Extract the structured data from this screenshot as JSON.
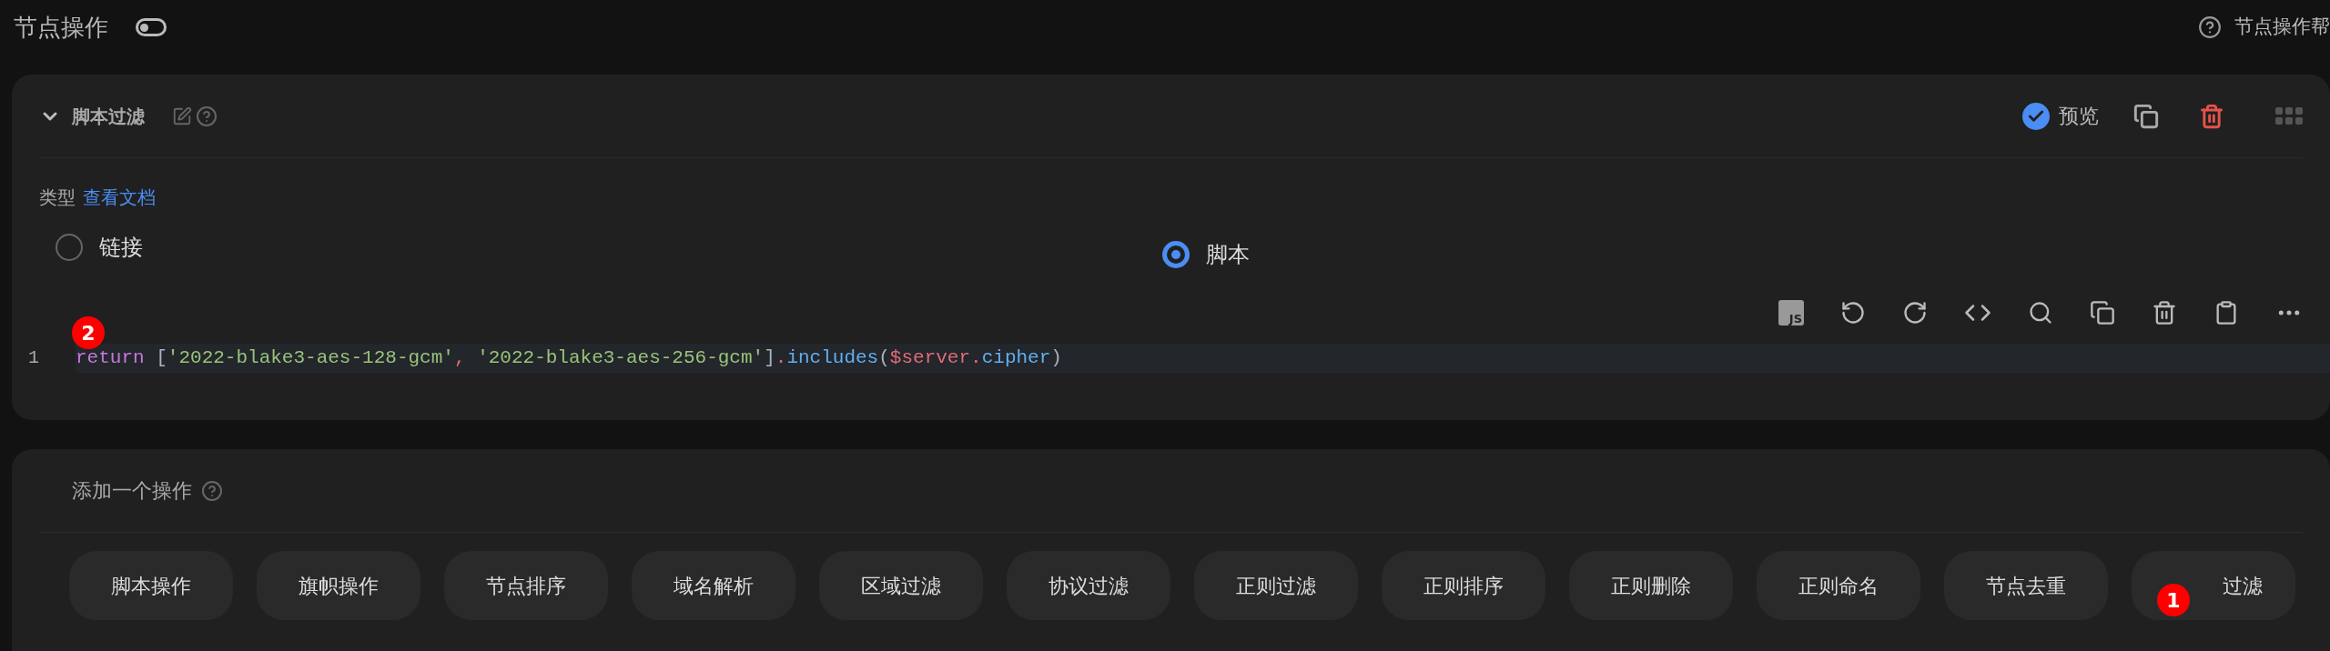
{
  "header": {
    "title": "节点操作",
    "toggle_on": false,
    "help": "节点操作帮"
  },
  "operation": {
    "title": "脚本过滤",
    "expanded": true,
    "preview": {
      "label": "预览",
      "checked": true
    },
    "type_label": "类型",
    "docs_link": "查看文档",
    "types": [
      {
        "label": "链接",
        "selected": false
      },
      {
        "label": "脚本",
        "selected": true
      }
    ],
    "editor": {
      "line_number": "1",
      "tokens": [
        {
          "kind": "keyword",
          "text": "return"
        },
        {
          "kind": "plain",
          "text": " ["
        },
        {
          "kind": "string",
          "text": "'2022-blake3-aes-128-gcm'"
        },
        {
          "kind": "punct",
          "text": ", "
        },
        {
          "kind": "string",
          "text": "'2022-blake3-aes-256-gcm'"
        },
        {
          "kind": "plain",
          "text": "]"
        },
        {
          "kind": "punct",
          "text": "."
        },
        {
          "kind": "method",
          "text": "includes"
        },
        {
          "kind": "plain",
          "text": "("
        },
        {
          "kind": "variable",
          "text": "$server"
        },
        {
          "kind": "punct",
          "text": "."
        },
        {
          "kind": "method",
          "text": "cipher"
        },
        {
          "kind": "plain",
          "text": ")"
        }
      ],
      "toolbar_badge": "JS",
      "annotation": "2"
    }
  },
  "add_operation": {
    "title": "添加一个操作",
    "buttons": [
      {
        "label": "脚本操作"
      },
      {
        "label": "旗帜操作"
      },
      {
        "label": "节点排序"
      },
      {
        "label": "域名解析"
      },
      {
        "label": "区域过滤"
      },
      {
        "label": "协议过滤"
      },
      {
        "label": "正则过滤"
      },
      {
        "label": "正则排序"
      },
      {
        "label": "正则删除"
      },
      {
        "label": "正则命名"
      },
      {
        "label": "节点去重"
      },
      {
        "label": "过滤",
        "annotation": "1"
      }
    ]
  }
}
